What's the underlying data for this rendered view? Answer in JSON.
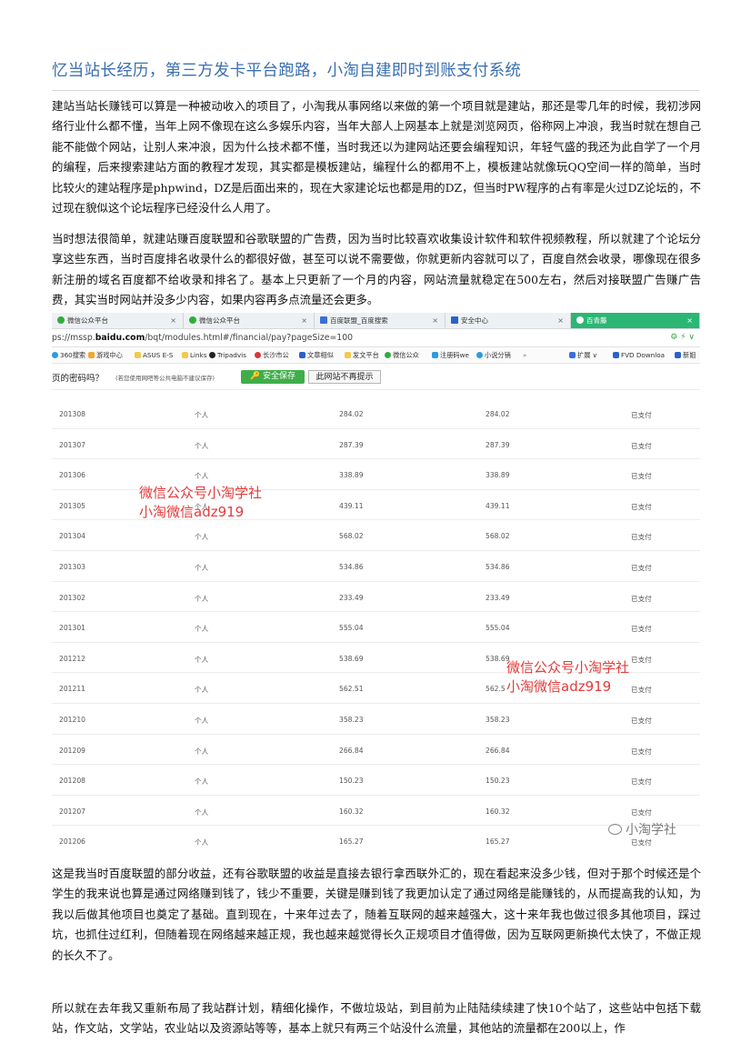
{
  "title": "忆当站长经历，第三方发卡平台跑路，小淘自建即时到账支付系统",
  "paragraphs": [
    "建站当站长赚钱可以算是一种被动收入的项目了，小淘我从事网络以来做的第一个项目就是建站，那还是零几年的时候，我初涉网络行业什么都不懂，当年上网不像现在这么多娱乐内容，当年大部人上网基本上就是浏览网页，俗称网上冲浪，我当时就在想自己能不能做个网站，让别人来冲浪，因为什么技术都不懂，当时我还以为建网站还要会编程知识，年轻气盛的我还为此自学了一个月的编程，后来搜索建站方面的教程才发现，其实都是模板建站，编程什么的都用不上，模板建站就像玩QQ空间一样的简单，当时比较火的建站程序是phpwind，DZ是后面出来的，现在大家建论坛也都是用的DZ，但当时PW程序的占有率是火过DZ论坛的，不过现在貌似这个论坛程序已经没什么人用了。",
    "当时想法很简单，就建站赚百度联盟和谷歌联盟的广告费，因为当时比较喜欢收集设计软件和软件视频教程，所以就建了个论坛分享这些东西，当时百度排名收录什么的都很好做，甚至可以说不需要做，你就更新内容就可以了，百度自然会收录，哪像现在很多新注册的域名百度都不给收录和排名了。基本上只更新了一个月的内容，网站流量就稳定在500左右，然后对接联盟广告赚广告费，其实当时网站并没多少内容，如果内容再多点流量还会更多。",
    "这是我当时百度联盟的部分收益，还有谷歌联盟的收益是直接去银行拿西联外汇的，现在看起来没多少钱，但对于那个时候还是个学生的我来说也算是通过网络赚到钱了，钱少不重要，关键是赚到钱了我更加认定了通过网络是能赚钱的，从而提高我的认知，为我以后做其他项目也奠定了基础。直到现在，十来年过去了，随着互联网的越来越强大，这十来年我也做过很多其他项目，踩过坑，也抓住过红利，但随着现在网络越来越正规，我也越来越觉得长久正规项目才值得做，因为互联网更新换代太快了，不做正规的长久不了。",
    "所以就在去年我又重新布局了我站群计划，精细化操作，不做垃圾站，到目前为止陆陆续续建了快10个站了，这些站中包括下载站，作文站，文学站，农业站以及资源站等等，基本上就只有两三个站没什么流量，其他站的流量都在200以上，作"
  ],
  "browser": {
    "tabs": [
      {
        "label": "微信公众平台",
        "color": "#2fae3c",
        "close": "×"
      },
      {
        "label": "微信公众平台",
        "color": "#2fae3c",
        "close": "×"
      },
      {
        "label": "百度联盟_百度搜索",
        "color": "#3b6fd8",
        "close": "×"
      },
      {
        "label": "安全中心",
        "color": "#2a62c9",
        "close": "×"
      },
      {
        "label": "百青藤",
        "color": "#ffffff",
        "close": "×"
      }
    ],
    "url_prefix": "ps://mssp.",
    "url_domain": "baidu.com",
    "url_path": "/bqt/modules.html#/financial/pay?pageSize=100",
    "url_icons": "⚙ ⚡ ∨",
    "bookmarks": [
      {
        "label": "360搜索",
        "color": "#2c9be0"
      },
      {
        "label": "游戏中心",
        "color": "#f0a830"
      },
      {
        "label": "ASUS E-S",
        "color": "#f2c94c"
      },
      {
        "label": "Links",
        "color": "#f2c94c"
      },
      {
        "label": "Tripadvis",
        "color": "#222222"
      },
      {
        "label": "长沙市公",
        "color": "#d33"
      },
      {
        "label": "文章相似",
        "color": "#2a62c9"
      },
      {
        "label": "发文平台",
        "color": "#f2c94c"
      },
      {
        "label": "微信公众",
        "color": "#2fae3c"
      },
      {
        "label": "注册码we",
        "color": "#2c9be0"
      },
      {
        "label": "小说分销",
        "color": "#2c9be0"
      },
      {
        "label": "»",
        "color": ""
      },
      {
        "label": "扩展 ∨",
        "color": "#3b6fd8"
      },
      {
        "label": "FVD Downloa",
        "color": "#2a62c9"
      },
      {
        "label": "新姐",
        "color": "#2a62c9"
      }
    ],
    "password_prompt": "页的密码吗？",
    "password_note": "(若您使用网吧等公共电脑不建议保存)",
    "save_button": "安全保存",
    "no_prompt_button": "此网站不再提示"
  },
  "table": {
    "rows": [
      {
        "period": "201308",
        "type": "个人",
        "amount": "284.02",
        "paid": "284.02",
        "status": "已支付"
      },
      {
        "period": "201307",
        "type": "个人",
        "amount": "287.39",
        "paid": "287.39",
        "status": "已支付"
      },
      {
        "period": "201306",
        "type": "个人",
        "amount": "338.89",
        "paid": "338.89",
        "status": "已支付"
      },
      {
        "period": "201305",
        "type": "个人",
        "amount": "439.11",
        "paid": "439.11",
        "status": "已支付"
      },
      {
        "period": "201304",
        "type": "个人",
        "amount": "568.02",
        "paid": "568.02",
        "status": "已支付"
      },
      {
        "period": "201303",
        "type": "个人",
        "amount": "534.86",
        "paid": "534.86",
        "status": "已支付"
      },
      {
        "period": "201302",
        "type": "个人",
        "amount": "233.49",
        "paid": "233.49",
        "status": "已支付"
      },
      {
        "period": "201301",
        "type": "个人",
        "amount": "555.04",
        "paid": "555.04",
        "status": "已支付"
      },
      {
        "period": "201212",
        "type": "个人",
        "amount": "538.69",
        "paid": "538.69",
        "status": "已支付"
      },
      {
        "period": "201211",
        "type": "个人",
        "amount": "562.51",
        "paid": "562.5",
        "status": "已支付"
      },
      {
        "period": "201210",
        "type": "个人",
        "amount": "358.23",
        "paid": "358.23",
        "status": "已支付"
      },
      {
        "period": "201209",
        "type": "个人",
        "amount": "266.84",
        "paid": "266.84",
        "status": "已支付"
      },
      {
        "period": "201208",
        "type": "个人",
        "amount": "150.23",
        "paid": "150.23",
        "status": "已支付"
      },
      {
        "period": "201207",
        "type": "个人",
        "amount": "160.32",
        "paid": "160.32",
        "status": "已支付"
      },
      {
        "period": "201206",
        "type": "个人",
        "amount": "165.27",
        "paid": "165.27",
        "status": "已支付"
      }
    ]
  },
  "watermarks": {
    "line1": "微信公众号小淘学社",
    "line2": "小淘微信adz919",
    "brand": "小淘学社"
  },
  "colors": {
    "title": "#3a6fb0",
    "watermark": "#e23b3b",
    "save_button": "#3fae4a",
    "active_tab": "#2bb673"
  }
}
